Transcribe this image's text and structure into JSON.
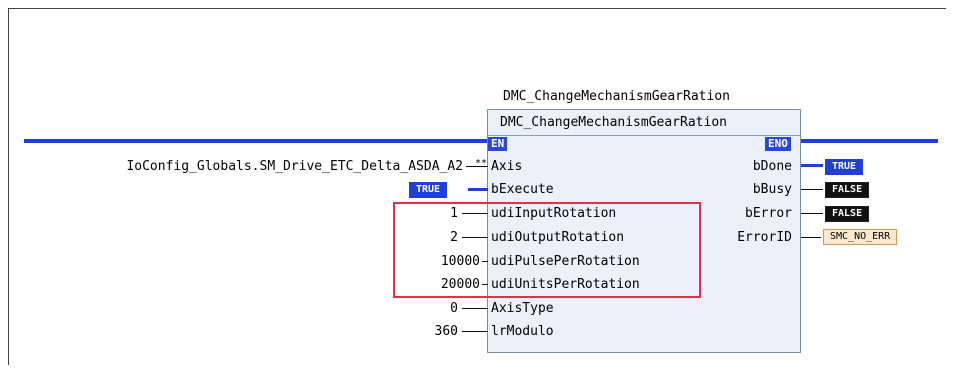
{
  "block": {
    "instance_title": "DMC_ChangeMechanismGearRation",
    "type_name": "DMC_ChangeMechanismGearRation",
    "en_label": "EN",
    "eno_label": "ENO"
  },
  "inputs": [
    {
      "pin": "Axis",
      "value": "IoConfig_Globals.SM_Drive_ETC_Delta_ASDA_A2",
      "connector": "**"
    },
    {
      "pin": "bExecute",
      "value": "TRUE"
    },
    {
      "pin": "udiInputRotation",
      "value": "1"
    },
    {
      "pin": "udiOutputRotation",
      "value": "2"
    },
    {
      "pin": "udiPulsePerRotation",
      "value": "10000"
    },
    {
      "pin": "udiUnitsPerRotation",
      "value": "20000"
    },
    {
      "pin": "AxisType",
      "value": "0"
    },
    {
      "pin": "lrModulo",
      "value": "360"
    }
  ],
  "outputs": [
    {
      "pin": "bDone",
      "value": "TRUE"
    },
    {
      "pin": "bBusy",
      "value": "FALSE"
    },
    {
      "pin": "bError",
      "value": "FALSE"
    },
    {
      "pin": "ErrorID",
      "value": "SMC_NO_ERR"
    }
  ],
  "colors": {
    "rail": "#1f3fd6",
    "block_fill": "#eaf1f8",
    "highlight": "#e03245",
    "true_value": "#1f3fd6",
    "false_value": "#111111",
    "error_value": "#fde7cf"
  }
}
